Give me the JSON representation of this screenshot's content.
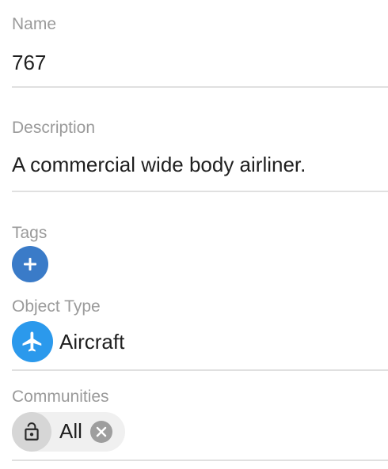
{
  "name": {
    "label": "Name",
    "value": "767"
  },
  "description": {
    "label": "Description",
    "value": "A commercial wide body airliner."
  },
  "tags": {
    "label": "Tags",
    "add_icon": "plus-icon",
    "add_color": "#3a7bc8"
  },
  "object_type": {
    "label": "Object Type",
    "value": "Aircraft",
    "icon": "airplane-icon",
    "icon_color": "#2b99ec"
  },
  "communities": {
    "label": "Communities",
    "chips": [
      {
        "label": "All",
        "icon": "lock-icon",
        "remove_icon": "close-icon"
      }
    ]
  }
}
